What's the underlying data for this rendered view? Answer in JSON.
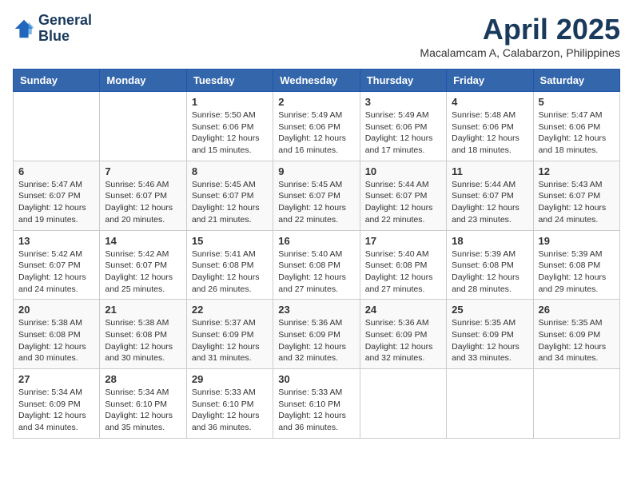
{
  "header": {
    "logo_line1": "General",
    "logo_line2": "Blue",
    "month": "April 2025",
    "location": "Macalamcam A, Calabarzon, Philippines"
  },
  "weekdays": [
    "Sunday",
    "Monday",
    "Tuesday",
    "Wednesday",
    "Thursday",
    "Friday",
    "Saturday"
  ],
  "weeks": [
    [
      {
        "day": "",
        "info": ""
      },
      {
        "day": "",
        "info": ""
      },
      {
        "day": "1",
        "info": "Sunrise: 5:50 AM\nSunset: 6:06 PM\nDaylight: 12 hours and 15 minutes."
      },
      {
        "day": "2",
        "info": "Sunrise: 5:49 AM\nSunset: 6:06 PM\nDaylight: 12 hours and 16 minutes."
      },
      {
        "day": "3",
        "info": "Sunrise: 5:49 AM\nSunset: 6:06 PM\nDaylight: 12 hours and 17 minutes."
      },
      {
        "day": "4",
        "info": "Sunrise: 5:48 AM\nSunset: 6:06 PM\nDaylight: 12 hours and 18 minutes."
      },
      {
        "day": "5",
        "info": "Sunrise: 5:47 AM\nSunset: 6:06 PM\nDaylight: 12 hours and 18 minutes."
      }
    ],
    [
      {
        "day": "6",
        "info": "Sunrise: 5:47 AM\nSunset: 6:07 PM\nDaylight: 12 hours and 19 minutes."
      },
      {
        "day": "7",
        "info": "Sunrise: 5:46 AM\nSunset: 6:07 PM\nDaylight: 12 hours and 20 minutes."
      },
      {
        "day": "8",
        "info": "Sunrise: 5:45 AM\nSunset: 6:07 PM\nDaylight: 12 hours and 21 minutes."
      },
      {
        "day": "9",
        "info": "Sunrise: 5:45 AM\nSunset: 6:07 PM\nDaylight: 12 hours and 22 minutes."
      },
      {
        "day": "10",
        "info": "Sunrise: 5:44 AM\nSunset: 6:07 PM\nDaylight: 12 hours and 22 minutes."
      },
      {
        "day": "11",
        "info": "Sunrise: 5:44 AM\nSunset: 6:07 PM\nDaylight: 12 hours and 23 minutes."
      },
      {
        "day": "12",
        "info": "Sunrise: 5:43 AM\nSunset: 6:07 PM\nDaylight: 12 hours and 24 minutes."
      }
    ],
    [
      {
        "day": "13",
        "info": "Sunrise: 5:42 AM\nSunset: 6:07 PM\nDaylight: 12 hours and 24 minutes."
      },
      {
        "day": "14",
        "info": "Sunrise: 5:42 AM\nSunset: 6:07 PM\nDaylight: 12 hours and 25 minutes."
      },
      {
        "day": "15",
        "info": "Sunrise: 5:41 AM\nSunset: 6:08 PM\nDaylight: 12 hours and 26 minutes."
      },
      {
        "day": "16",
        "info": "Sunrise: 5:40 AM\nSunset: 6:08 PM\nDaylight: 12 hours and 27 minutes."
      },
      {
        "day": "17",
        "info": "Sunrise: 5:40 AM\nSunset: 6:08 PM\nDaylight: 12 hours and 27 minutes."
      },
      {
        "day": "18",
        "info": "Sunrise: 5:39 AM\nSunset: 6:08 PM\nDaylight: 12 hours and 28 minutes."
      },
      {
        "day": "19",
        "info": "Sunrise: 5:39 AM\nSunset: 6:08 PM\nDaylight: 12 hours and 29 minutes."
      }
    ],
    [
      {
        "day": "20",
        "info": "Sunrise: 5:38 AM\nSunset: 6:08 PM\nDaylight: 12 hours and 30 minutes."
      },
      {
        "day": "21",
        "info": "Sunrise: 5:38 AM\nSunset: 6:08 PM\nDaylight: 12 hours and 30 minutes."
      },
      {
        "day": "22",
        "info": "Sunrise: 5:37 AM\nSunset: 6:09 PM\nDaylight: 12 hours and 31 minutes."
      },
      {
        "day": "23",
        "info": "Sunrise: 5:36 AM\nSunset: 6:09 PM\nDaylight: 12 hours and 32 minutes."
      },
      {
        "day": "24",
        "info": "Sunrise: 5:36 AM\nSunset: 6:09 PM\nDaylight: 12 hours and 32 minutes."
      },
      {
        "day": "25",
        "info": "Sunrise: 5:35 AM\nSunset: 6:09 PM\nDaylight: 12 hours and 33 minutes."
      },
      {
        "day": "26",
        "info": "Sunrise: 5:35 AM\nSunset: 6:09 PM\nDaylight: 12 hours and 34 minutes."
      }
    ],
    [
      {
        "day": "27",
        "info": "Sunrise: 5:34 AM\nSunset: 6:09 PM\nDaylight: 12 hours and 34 minutes."
      },
      {
        "day": "28",
        "info": "Sunrise: 5:34 AM\nSunset: 6:10 PM\nDaylight: 12 hours and 35 minutes."
      },
      {
        "day": "29",
        "info": "Sunrise: 5:33 AM\nSunset: 6:10 PM\nDaylight: 12 hours and 36 minutes."
      },
      {
        "day": "30",
        "info": "Sunrise: 5:33 AM\nSunset: 6:10 PM\nDaylight: 12 hours and 36 minutes."
      },
      {
        "day": "",
        "info": ""
      },
      {
        "day": "",
        "info": ""
      },
      {
        "day": "",
        "info": ""
      }
    ]
  ]
}
